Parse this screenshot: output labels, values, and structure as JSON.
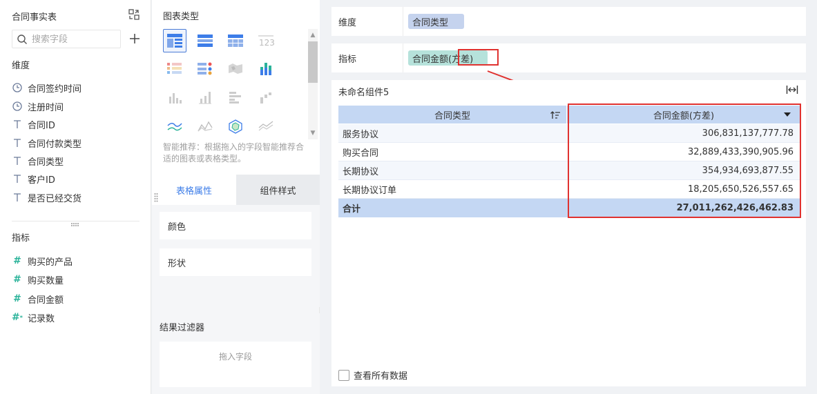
{
  "fields_panel": {
    "title": "合同事实表",
    "search_placeholder": "搜索字段",
    "dimension_label": "维度",
    "dimensions": [
      {
        "label": "合同签约时间",
        "icon": "clock-icon"
      },
      {
        "label": "注册时间",
        "icon": "clock-icon"
      },
      {
        "label": "合同ID",
        "icon": "text-icon"
      },
      {
        "label": "合同付款类型",
        "icon": "text-icon"
      },
      {
        "label": "合同类型",
        "icon": "text-icon"
      },
      {
        "label": "客户ID",
        "icon": "text-icon"
      },
      {
        "label": "是否已经交货",
        "icon": "text-icon"
      }
    ],
    "measure_label": "指标",
    "measures": [
      {
        "label": "购买的产品",
        "icon": "hash-icon"
      },
      {
        "label": "购买数量",
        "icon": "hash-icon"
      },
      {
        "label": "合同金额",
        "icon": "hash-icon"
      },
      {
        "label": "记录数",
        "icon": "hash-star-icon"
      }
    ]
  },
  "chart_panel": {
    "title": "图表类型",
    "hint": "智能推荐：根据拖入的字段智能推荐合适的图表或表格类型。",
    "tabs": [
      {
        "label": "表格属性",
        "active": true
      },
      {
        "label": "组件样式",
        "active": false
      }
    ],
    "properties": [
      {
        "label": "颜色"
      },
      {
        "label": "形状"
      }
    ],
    "filter_title": "结果过滤器",
    "filter_placeholder": "拖入字段"
  },
  "editor": {
    "dimension_region": {
      "label": "维度",
      "pill": "合同类型"
    },
    "measure_region": {
      "label": "指标",
      "pill": "合同金额(方差)"
    },
    "widget_title": "未命名组件5",
    "table": {
      "columns": [
        "合同类型",
        "合同金额(方差)"
      ],
      "rows": [
        {
          "type": "服务协议",
          "value": "306,831,137,777.78"
        },
        {
          "type": "购买合同",
          "value": "32,889,433,390,905.96"
        },
        {
          "type": "长期协议",
          "value": "354,934,693,877.55"
        },
        {
          "type": "长期协议订单",
          "value": "18,205,650,526,557.65"
        }
      ],
      "total": {
        "label": "合计",
        "value": "27,011,262,426,462.83"
      }
    },
    "show_all_label": "查看所有数据"
  },
  "colors": {
    "accent": "#3d7de8",
    "highlight_box": "#e0312f",
    "dimension_pill": "#c5d3ee",
    "measure_pill": "#b6e2db",
    "table_header": "#c4d7f3"
  }
}
